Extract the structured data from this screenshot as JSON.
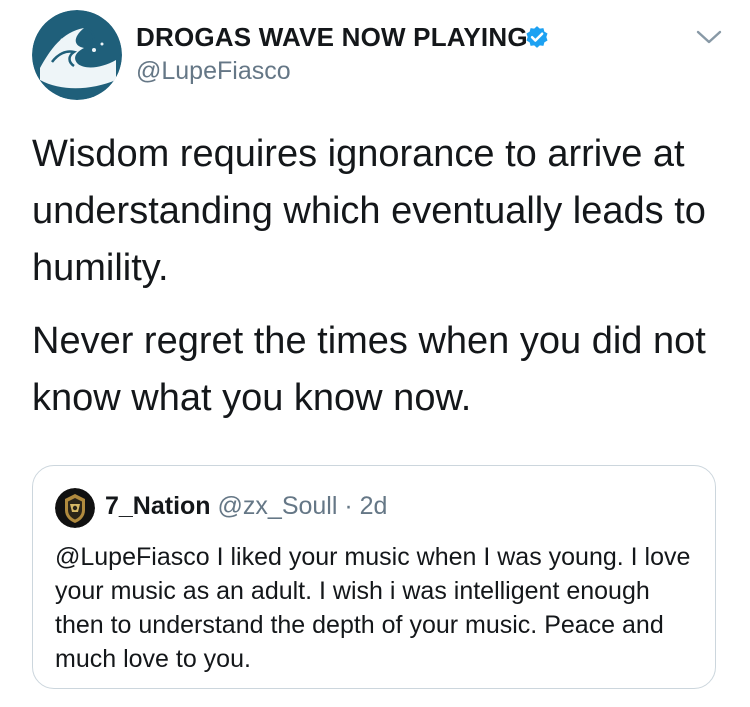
{
  "tweet": {
    "display_name": "DROGAS WAVE NOW PLAYING",
    "handle": "@LupeFiasco",
    "verified_icon": "verified-badge-icon",
    "menu_icon": "chevron-down-icon",
    "paragraphs": [
      "Wisdom requires ignorance to arrive at understanding which eventually leads to humility.",
      "Never regret the times when you did not know what you know now."
    ]
  },
  "quoted_tweet": {
    "display_name": "7_Nation",
    "handle": "@zx_Soull",
    "separator": "·",
    "time": "2d",
    "text": "@LupeFiasco I liked your music when I was young. I love your music as an adult. I wish i was intelligent enough then to understand the depth of your music. Peace and much love to you."
  },
  "colors": {
    "text_primary": "#14171a",
    "text_secondary": "#657786",
    "verified_blue": "#1da1f2",
    "border": "#ccd6dd",
    "avatar_wave": "#1f5f7a"
  }
}
